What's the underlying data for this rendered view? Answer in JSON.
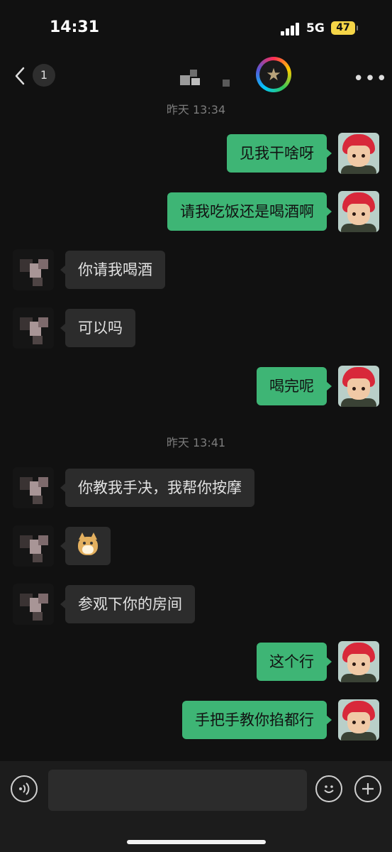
{
  "status_bar": {
    "time": "14:31",
    "network": "5G",
    "battery": "47"
  },
  "nav": {
    "unread_count": "1",
    "icons": [
      "chevron-left-icon",
      "more-dots-icon"
    ]
  },
  "timestamps": [
    "昨天 13:34",
    "昨天 13:41"
  ],
  "messages": [
    {
      "from": "me",
      "text": "见我干啥呀"
    },
    {
      "from": "me",
      "text": "请我吃饭还是喝酒啊"
    },
    {
      "from": "other",
      "text": "你请我喝酒"
    },
    {
      "from": "other",
      "text": "可以吗"
    },
    {
      "from": "me",
      "text": "喝完呢"
    },
    {
      "from": "other",
      "text": "你教我手决，我帮你按摩"
    },
    {
      "from": "other",
      "text": "",
      "emoji": "doge-emoji"
    },
    {
      "from": "other",
      "text": "参观下你的房间"
    },
    {
      "from": "me",
      "text": "这个行"
    },
    {
      "from": "me",
      "text": "手把手教你掐都行"
    }
  ],
  "input_bar": {
    "icons": [
      "voice-icon",
      "emoji-icon",
      "plus-icon"
    ]
  },
  "colors": {
    "my_bubble": "#3eb575",
    "other_bubble": "#2c2c2c",
    "background": "#111111"
  }
}
